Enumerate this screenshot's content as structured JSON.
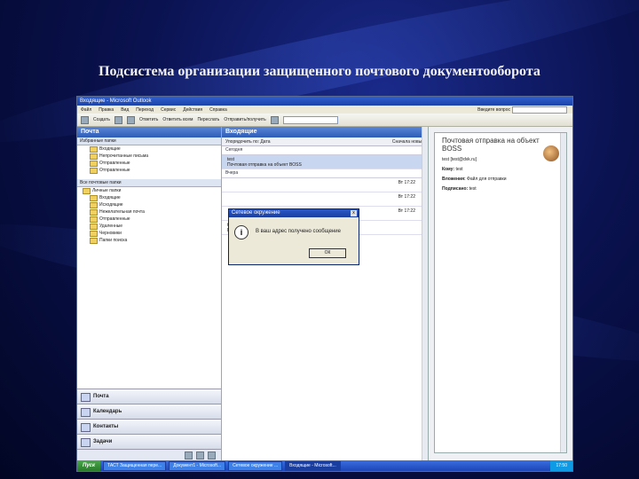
{
  "slide": {
    "title": "Подсистема организации защищенного почтового документооборота"
  },
  "window": {
    "title": "Входящие - Microsoft Outlook"
  },
  "menubar": {
    "items": [
      "Файл",
      "Правка",
      "Вид",
      "Переход",
      "Сервис",
      "Действия",
      "Справка"
    ],
    "question_placeholder": "Введите вопрос"
  },
  "toolbar": {
    "new": "Создать",
    "reply": "Ответить",
    "reply_all": "Ответить всем",
    "forward": "Переслать",
    "send_receive": "Отправить/получить",
    "find_placeholder": ""
  },
  "nav": {
    "header": "Почта",
    "favorites_title": "Избранные папки",
    "favorites": [
      "Входящие",
      "Непрочитанные письма",
      "Отправленные",
      "Отправленные"
    ],
    "all_folders_title": "Все почтовые папки",
    "tree_root": "Личные папки",
    "folders": [
      "Входящие",
      "Исходящие",
      "Нежелательная почта",
      "Отправленные",
      "Удаленные",
      "Черновики",
      "Папки поиска"
    ]
  },
  "nav_buttons": [
    "Почта",
    "Календарь",
    "Контакты",
    "Задачи"
  ],
  "list": {
    "header": "Входящие",
    "arrange_left": "Упорядочить по: Дата",
    "arrange_right": "Сначала новые",
    "group_today": "Сегодня",
    "group_yesterday": "Вчера",
    "messages": [
      {
        "from": "test",
        "subject": "Почтовая отправка на объект BOSS",
        "date": ""
      },
      {
        "from": "",
        "subject": "",
        "date": "Вт 17:22"
      },
      {
        "from": "",
        "subject": "",
        "date": "Вт 17:22"
      },
      {
        "from": "",
        "subject": "",
        "date": "Вт 17:22"
      },
      {
        "from": "test",
        "subject": "Пробный тест",
        "date": ""
      }
    ]
  },
  "dialog": {
    "title": "Сетевое окружение",
    "message": "В ваш адрес получено сообщение",
    "ok": "ОК",
    "icon": "info-icon"
  },
  "reading": {
    "title": "Почтовая отправка на объект BOSS",
    "from": "test [test@dvk.ru]",
    "to_label": "Кому:",
    "to_value": "test",
    "attach_label": "Вложения:",
    "attach_value": "Файл для отправки",
    "sign_label": "Подписано:",
    "sign_value": "test"
  },
  "taskbar": {
    "start": "Пуск",
    "tasks": [
      "ТАСТ Защищенная пере...",
      "Документ1 - Microsoft...",
      "Сетевое окружение ...",
      "Входящие - Microsoft..."
    ],
    "clock": "17:50"
  }
}
